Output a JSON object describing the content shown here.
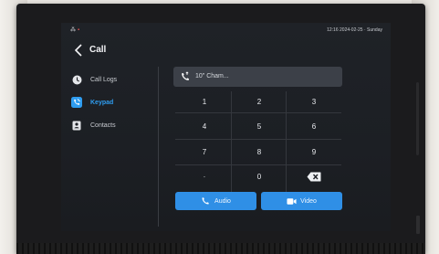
{
  "status": {
    "time": "12:16  2024-02-25 · Sunday"
  },
  "header": {
    "title": "Call"
  },
  "sidebar": {
    "items": [
      {
        "label": "Call Logs",
        "icon": "clock-icon"
      },
      {
        "label": "Keypad",
        "icon": "keypad-phone-icon",
        "active": true
      },
      {
        "label": "Contacts",
        "icon": "contacts-icon"
      }
    ]
  },
  "number_field": {
    "value": "10\" Cham..."
  },
  "keypad": {
    "keys": [
      "1",
      "2",
      "3",
      "4",
      "5",
      "6",
      "7",
      "8",
      "9",
      "·",
      "0"
    ]
  },
  "actions": {
    "audio_label": "Audio",
    "video_label": "Video"
  },
  "colors": {
    "accent": "#2f8fe6",
    "screen_bg": "#1f2227"
  }
}
